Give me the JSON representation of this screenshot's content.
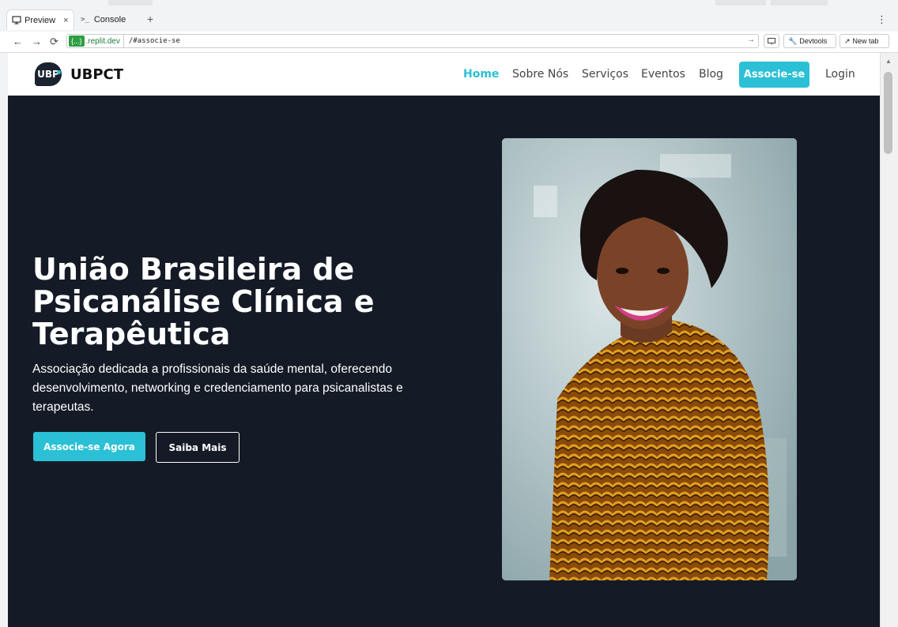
{
  "browser": {
    "tabs": [
      {
        "label": "Preview",
        "close": "×"
      },
      {
        "label": "Console"
      }
    ],
    "new_tab": "+",
    "url_badge": "{...}",
    "url_host": ".replit.dev",
    "url_path": "/#associe-se",
    "devtools_label": "Devtools",
    "newtab_label": "New tab"
  },
  "site": {
    "logo_text": "UBP",
    "brand": "UBPCT",
    "nav": [
      "Home",
      "Sobre Nós",
      "Serviços",
      "Eventos",
      "Blog"
    ],
    "nav_cta": "Associe-se",
    "login": "Login"
  },
  "hero": {
    "title": "União Brasileira de Psicanálise Clínica e Terapêutica",
    "subtitle": "Associação dedicada a profissionais da saúde mental, oferecendo desenvolvimento, networking e credenciamento para psicanalistas e terapeutas.",
    "primary_button": "Associe-se Agora",
    "secondary_button": "Saiba Mais"
  },
  "colors": {
    "accent": "#2bc0d6",
    "hero_bg": "#141b26"
  }
}
